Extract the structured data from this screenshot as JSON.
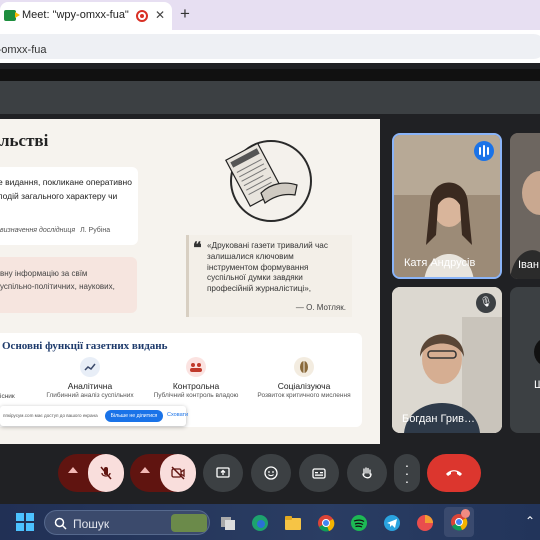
{
  "browser": {
    "tab_title": "Meet: \"wpy-omxx-fua\"",
    "tab_close": "✕",
    "new_tab": "+",
    "url": "py-omxx-fua"
  },
  "slide": {
    "title": "льстві",
    "definition_lines": [
      "е видання, покликане оперативно",
      "подій загального характеру чи"
    ],
    "definition_note": "визначення дослідниця",
    "definition_author": "Л. Рубіна",
    "info_lines": [
      "вну інформацію за свїм",
      "успільно-політичних, наукових,"
    ],
    "quote_mark": "❝",
    "quote_lines": [
      "«Друковані газети тривалий час",
      "залишалися ключовим",
      "інструментом формування",
      "суспільної думки завдяки",
      "професійній журналістиці»,"
    ],
    "quote_author": "— О. Мотляк.",
    "functions_title": "Основні функції газетних видань",
    "functions_left_fragment": "існик",
    "functions": [
      {
        "name": "Аналітична",
        "desc": "Глибинний аналіз суспільних",
        "icon": "chart-icon",
        "color": "#e8eef7"
      },
      {
        "name": "Контрольна",
        "desc": "Публічний контроль владою",
        "icon": "people-icon",
        "color": "#fbe3e1"
      },
      {
        "name": "Соціалізуюча",
        "desc": "Розвиток критичного мислення",
        "icon": "brain-icon",
        "color": "#f3ece0"
      }
    ],
    "notice": {
      "text": "ппкірусум.com має доступ до вашого екрана",
      "button": "Більше не ділитися",
      "hide": "Сховати"
    }
  },
  "participants": [
    {
      "name": "Катя Андрусів"
    },
    {
      "name": "Іван"
    },
    {
      "name": "Богдан Грив…"
    },
    {
      "name": "Ш"
    }
  ],
  "controls": {
    "mic_muted": true,
    "camera_off": true,
    "colors": {
      "muted_bg": "#f9dedc",
      "muted_dark": "#601410",
      "end_call": "#dc362e",
      "neutral": "#3c4043"
    }
  },
  "taskbar": {
    "search_label": "Пошук"
  }
}
